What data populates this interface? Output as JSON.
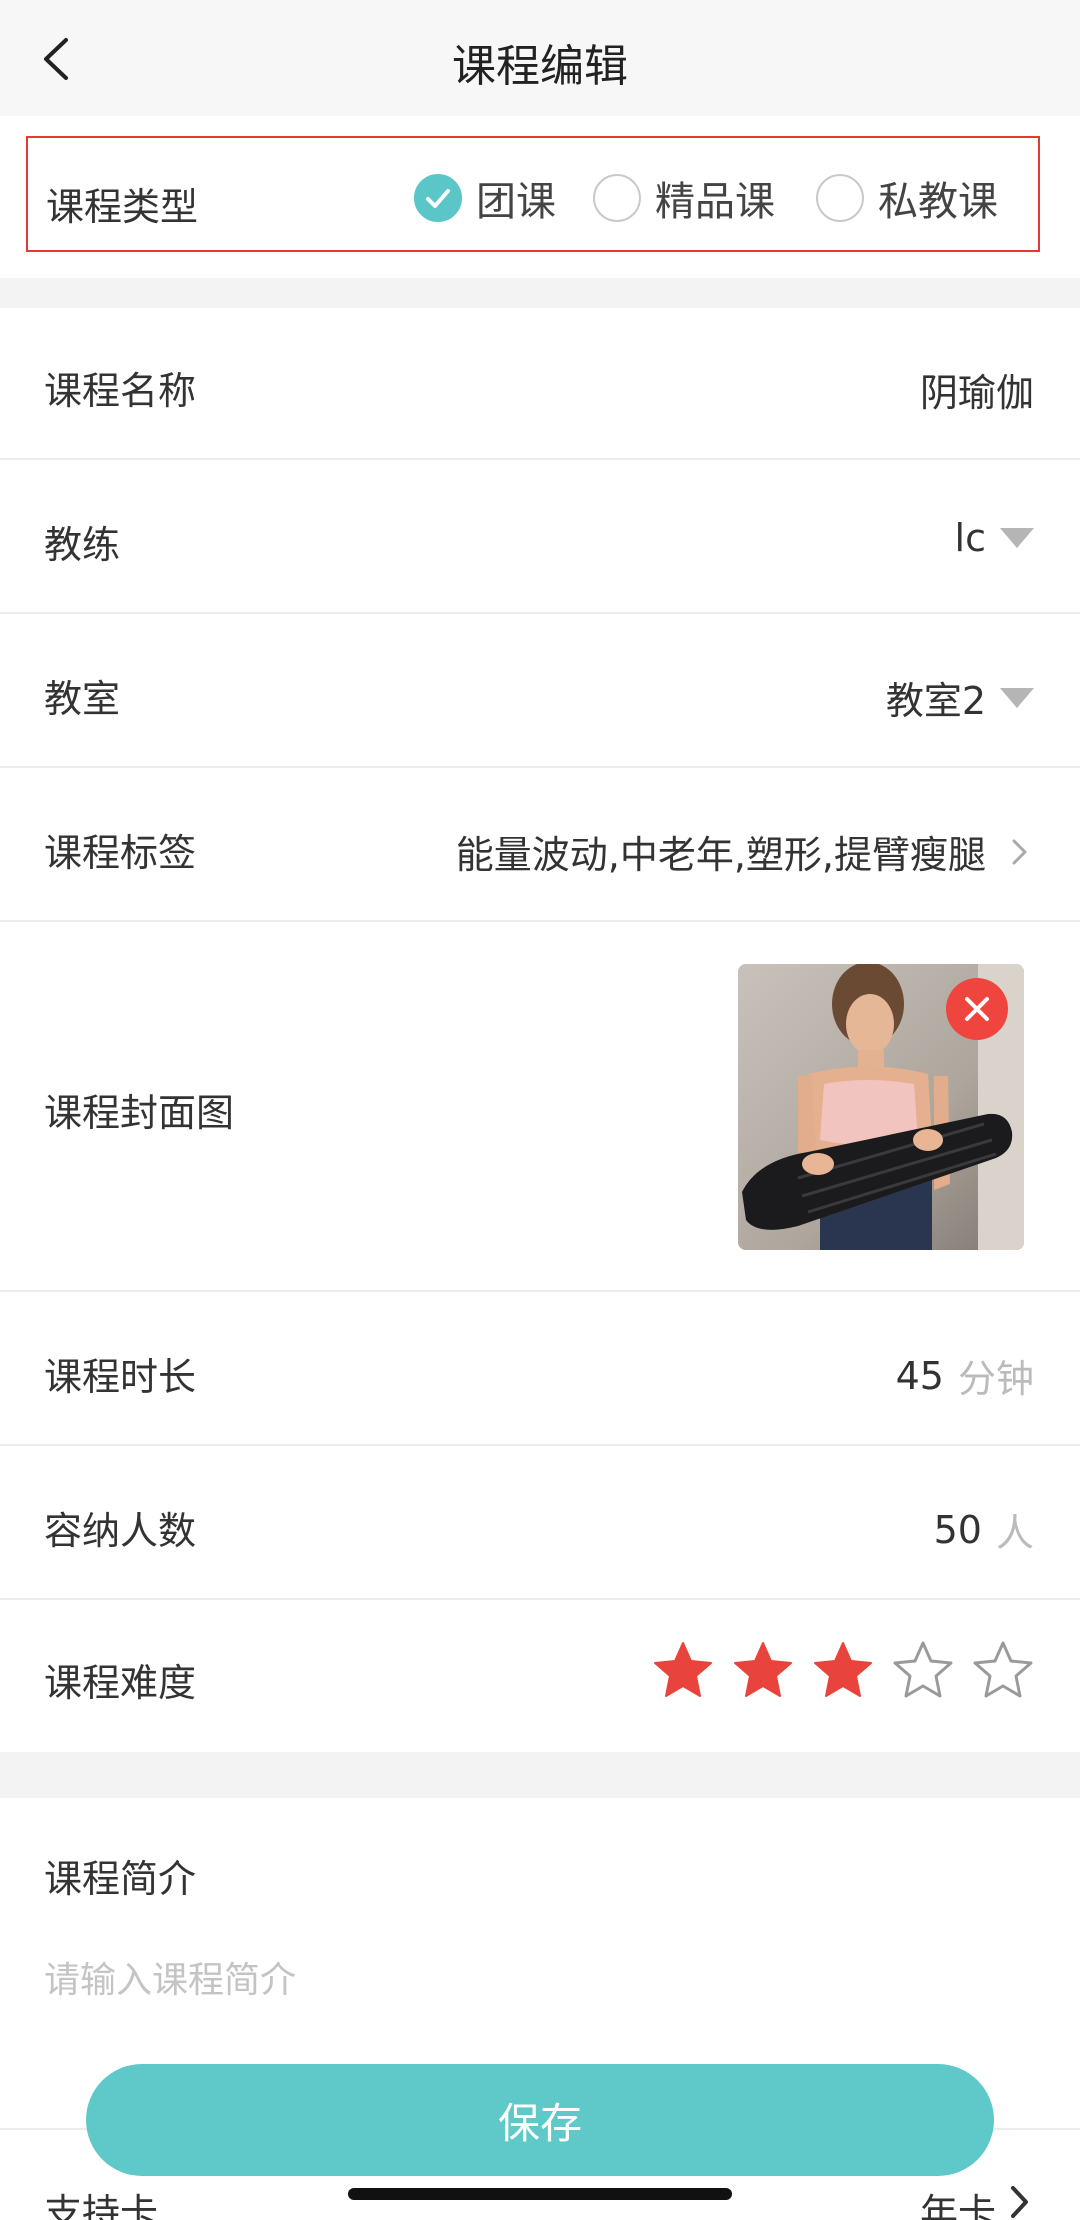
{
  "nav": {
    "title": "课程编辑",
    "back_icon": "chevron-left-icon"
  },
  "course_type": {
    "label": "课程类型",
    "options": [
      {
        "label": "团课",
        "selected": true
      },
      {
        "label": "精品课",
        "selected": false
      },
      {
        "label": "私教课",
        "selected": false
      }
    ]
  },
  "fields": {
    "name": {
      "label": "课程名称",
      "value": "阴瑜伽"
    },
    "coach": {
      "label": "教练",
      "value": "lc"
    },
    "room": {
      "label": "教室",
      "value": "教室2"
    },
    "tags": {
      "label": "课程标签",
      "value": "能量波动,中老年,塑形,提臂瘦腿"
    },
    "cover": {
      "label": "课程封面图"
    },
    "duration": {
      "label": "课程时长",
      "value": "45",
      "unit": "分钟"
    },
    "capacity": {
      "label": "容纳人数",
      "value": "50",
      "unit": "人"
    },
    "difficulty": {
      "label": "课程难度",
      "rating": 3,
      "max": 5
    }
  },
  "intro": {
    "label": "课程简介",
    "placeholder": "请输入课程简介"
  },
  "support_card": {
    "label": "支持卡",
    "value": "年卡"
  },
  "save_label": "保存",
  "colors": {
    "accent": "#5ec9c8",
    "star_on": "#e8433c",
    "delete": "#f0443e",
    "highlight_border": "#e53935"
  }
}
